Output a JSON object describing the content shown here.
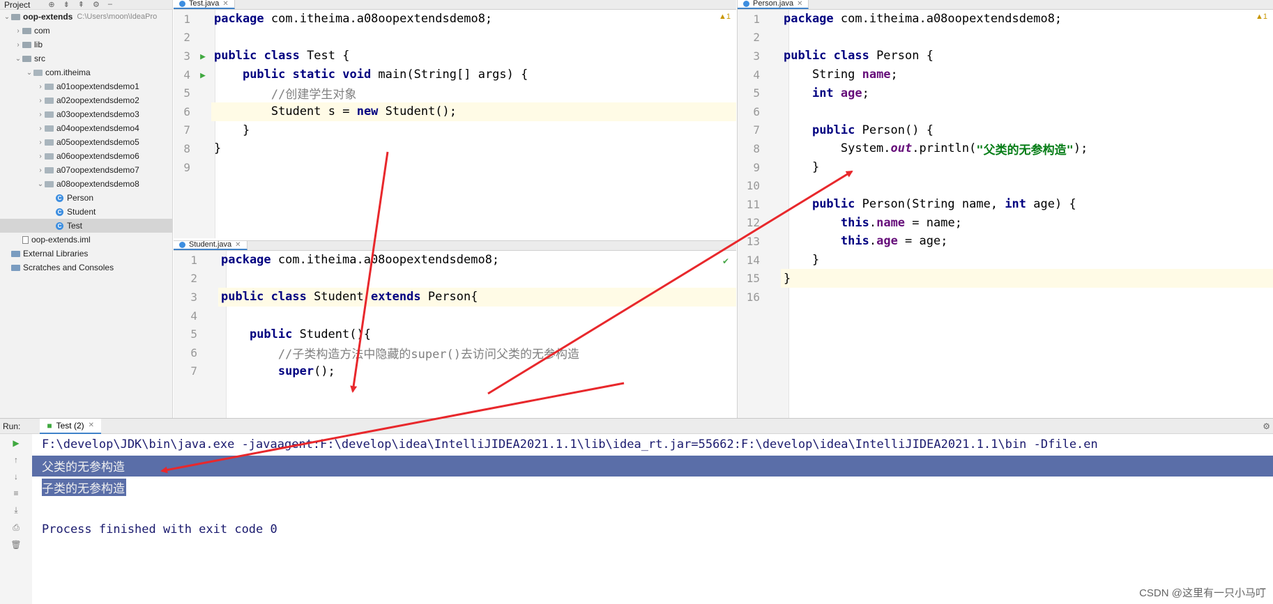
{
  "project": {
    "header": "Project",
    "items": [
      {
        "label": "oop-extends",
        "hint": "C:\\Users\\moon\\IdeaPro",
        "type": "root",
        "depth": 0,
        "open": true
      },
      {
        "label": "com",
        "type": "folder",
        "depth": 1,
        "open": false
      },
      {
        "label": "lib",
        "type": "folder",
        "depth": 1,
        "open": false
      },
      {
        "label": "src",
        "type": "folder",
        "depth": 1,
        "open": true
      },
      {
        "label": "com.itheima",
        "type": "pkg",
        "depth": 2,
        "open": true
      },
      {
        "label": "a01oopextendsdemo1",
        "type": "pkg",
        "depth": 3,
        "open": false
      },
      {
        "label": "a02oopextendsdemo2",
        "type": "pkg",
        "depth": 3,
        "open": false
      },
      {
        "label": "a03oopextendsdemo3",
        "type": "pkg",
        "depth": 3,
        "open": false
      },
      {
        "label": "a04oopextendsdemo4",
        "type": "pkg",
        "depth": 3,
        "open": false
      },
      {
        "label": "a05oopextendsdemo5",
        "type": "pkg",
        "depth": 3,
        "open": false
      },
      {
        "label": "a06oopextendsdemo6",
        "type": "pkg",
        "depth": 3,
        "open": false
      },
      {
        "label": "a07oopextendsdemo7",
        "type": "pkg",
        "depth": 3,
        "open": false
      },
      {
        "label": "a08oopextendsdemo8",
        "type": "pkg",
        "depth": 3,
        "open": true
      },
      {
        "label": "Person",
        "type": "class",
        "depth": 4
      },
      {
        "label": "Student",
        "type": "class",
        "depth": 4
      },
      {
        "label": "Test",
        "type": "class",
        "depth": 4,
        "selected": true
      },
      {
        "label": "oop-extends.iml",
        "type": "file",
        "depth": 1
      },
      {
        "label": "External Libraries",
        "type": "lib",
        "depth": 0
      },
      {
        "label": "Scratches and Consoles",
        "type": "lib",
        "depth": 0
      }
    ]
  },
  "editors": {
    "test": {
      "tab": "Test.java",
      "warning": "▲1",
      "lines": [
        {
          "n": "1",
          "tokens": [
            [
              "kw",
              "package"
            ],
            [
              "",
              " com.itheima.a08oopextendsdemo8;"
            ]
          ]
        },
        {
          "n": "2",
          "tokens": []
        },
        {
          "n": "3",
          "run": true,
          "tokens": [
            [
              "kw",
              "public class"
            ],
            [
              "",
              " Test {"
            ]
          ]
        },
        {
          "n": "4",
          "run": true,
          "tokens": [
            [
              "",
              "    "
            ],
            [
              "kw",
              "public static void"
            ],
            [
              "",
              " main(String[] args) {"
            ]
          ]
        },
        {
          "n": "5",
          "tokens": [
            [
              "",
              "        "
            ],
            [
              "cm",
              "//创建学生对象"
            ]
          ]
        },
        {
          "n": "6",
          "hl": true,
          "tokens": [
            [
              "",
              "        Student s = "
            ],
            [
              "kw",
              "new"
            ],
            [
              "",
              " Student();"
            ]
          ]
        },
        {
          "n": "7",
          "tokens": [
            [
              "",
              "    }"
            ]
          ]
        },
        {
          "n": "8",
          "tokens": [
            [
              "",
              "}"
            ]
          ]
        },
        {
          "n": "9",
          "tokens": []
        }
      ]
    },
    "student": {
      "tab": "Student.java",
      "lines": [
        {
          "n": "1",
          "tokens": [
            [
              "kw",
              "package"
            ],
            [
              "",
              " com.itheima.a08oopextendsdemo8;"
            ]
          ]
        },
        {
          "n": "2",
          "tokens": []
        },
        {
          "n": "3",
          "hl": true,
          "tokens": [
            [
              "kw",
              "public class"
            ],
            [
              "",
              " Student "
            ],
            [
              "kw",
              "extends"
            ],
            [
              "",
              " Person{"
            ]
          ]
        },
        {
          "n": "4",
          "tokens": []
        },
        {
          "n": "5",
          "tokens": [
            [
              "",
              "    "
            ],
            [
              "kw",
              "public"
            ],
            [
              "",
              " Student(){"
            ]
          ]
        },
        {
          "n": "6",
          "tokens": [
            [
              "",
              "        "
            ],
            [
              "cm",
              "//子类构造方法中隐藏的super()去访问父类的无参构造"
            ]
          ]
        },
        {
          "n": "7",
          "tokens": [
            [
              "",
              "        "
            ],
            [
              "kw",
              "super"
            ],
            [
              "",
              "();"
            ]
          ]
        }
      ]
    },
    "person": {
      "tab": "Person.java",
      "warning": "▲1",
      "lines": [
        {
          "n": "1",
          "tokens": [
            [
              "kw",
              "package"
            ],
            [
              "",
              " com.itheima.a08oopextendsdemo8;"
            ]
          ]
        },
        {
          "n": "2",
          "tokens": []
        },
        {
          "n": "3",
          "tokens": [
            [
              "kw",
              "public class"
            ],
            [
              "",
              " Person {"
            ]
          ]
        },
        {
          "n": "4",
          "tokens": [
            [
              "",
              "    String "
            ],
            [
              "fld",
              "name"
            ],
            [
              "",
              ";"
            ]
          ]
        },
        {
          "n": "5",
          "tokens": [
            [
              "",
              "    "
            ],
            [
              "kw",
              "int"
            ],
            [
              "",
              " "
            ],
            [
              "fld",
              "age"
            ],
            [
              "",
              ";"
            ]
          ]
        },
        {
          "n": "6",
          "tokens": []
        },
        {
          "n": "7",
          "tokens": [
            [
              "",
              "    "
            ],
            [
              "kw",
              "public"
            ],
            [
              "",
              " Person() {"
            ]
          ]
        },
        {
          "n": "8",
          "tokens": [
            [
              "",
              "        System."
            ],
            [
              "it",
              "out"
            ],
            [
              "",
              ".println("
            ],
            [
              "str",
              "\"父类的无参构造\""
            ],
            [
              "",
              ");"
            ]
          ]
        },
        {
          "n": "9",
          "tokens": [
            [
              "",
              "    }"
            ]
          ]
        },
        {
          "n": "10",
          "tokens": []
        },
        {
          "n": "11",
          "tokens": [
            [
              "",
              "    "
            ],
            [
              "kw",
              "public"
            ],
            [
              "",
              " Person(String name, "
            ],
            [
              "kw",
              "int"
            ],
            [
              "",
              " age) {"
            ]
          ]
        },
        {
          "n": "12",
          "tokens": [
            [
              "",
              "        "
            ],
            [
              "kw",
              "this"
            ],
            [
              "",
              "."
            ],
            [
              "fld",
              "name"
            ],
            [
              "",
              " = name;"
            ]
          ]
        },
        {
          "n": "13",
          "tokens": [
            [
              "",
              "        "
            ],
            [
              "kw",
              "this"
            ],
            [
              "",
              "."
            ],
            [
              "fld",
              "age"
            ],
            [
              "",
              " = age;"
            ]
          ]
        },
        {
          "n": "14",
          "tokens": [
            [
              "",
              "    }"
            ]
          ]
        },
        {
          "n": "15",
          "hl": true,
          "tokens": [
            [
              "",
              "}"
            ]
          ]
        },
        {
          "n": "16",
          "tokens": []
        }
      ]
    }
  },
  "run": {
    "label": "Run:",
    "tab": "Test (2)",
    "command": "F:\\develop\\JDK\\bin\\java.exe -javaagent:F:\\develop\\idea\\IntelliJIDEA2021.1.1\\lib\\idea_rt.jar=55662:F:\\develop\\idea\\IntelliJIDEA2021.1.1\\bin -Dfile.en",
    "output1": "父类的无参构造",
    "output2": "子类的无参构造",
    "finished": "Process finished with exit code 0"
  },
  "watermark": "CSDN @这里有一只小马叮",
  "colors": {
    "arrow": "#e8282c",
    "selection": "#5a6ea8",
    "keyword": "#000080"
  }
}
